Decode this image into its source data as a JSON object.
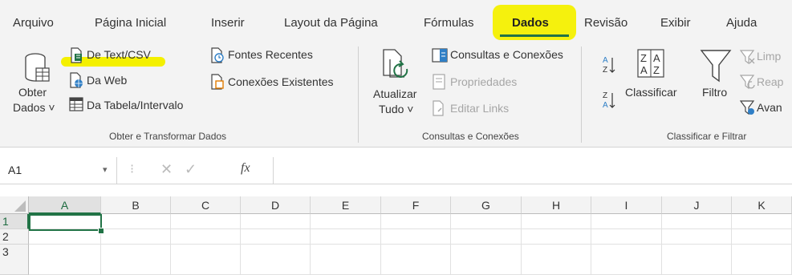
{
  "tabs": [
    {
      "label": "Arquivo"
    },
    {
      "label": "Página Inicial"
    },
    {
      "label": "Inserir"
    },
    {
      "label": "Layout da Página"
    },
    {
      "label": "Fórmulas"
    },
    {
      "label": "Dados"
    },
    {
      "label": "Revisão"
    },
    {
      "label": "Exibir"
    },
    {
      "label": "Ajuda"
    }
  ],
  "active_tab": "Dados",
  "groups": {
    "get_transform": {
      "label": "Obter e Transformar Dados",
      "get_data_line1": "Obter",
      "get_data_line2": "Dados ˅",
      "from_text": "De Text/CSV",
      "from_web": "Da Web",
      "from_table": "Da Tabela/Intervalo",
      "recent_sources": "Fontes Recentes",
      "existing_connections": "Conexões Existentes"
    },
    "queries_connections": {
      "label": "Consultas e Conexões",
      "refresh_line1": "Atualizar",
      "refresh_line2": "Tudo ˅",
      "queries_connections": "Consultas e Conexões",
      "properties": "Propriedades",
      "edit_links": "Editar Links"
    },
    "sort_filter": {
      "label": "Classificar e Filtrar",
      "sort": "Classificar",
      "filter": "Filtro",
      "clear": "Limp",
      "reapply": "Reap",
      "advanced": "Avan"
    }
  },
  "formula_bar": {
    "name_box": "A1",
    "fx": "fx",
    "value": ""
  },
  "grid": {
    "columns": [
      "A",
      "B",
      "C",
      "D",
      "E",
      "F",
      "G",
      "H",
      "I",
      "J",
      "K"
    ],
    "rows": [
      "1",
      "2",
      "3"
    ],
    "selected_cell": "A1"
  },
  "colors": {
    "accent": "#217346",
    "highlight": "#f4f000"
  }
}
